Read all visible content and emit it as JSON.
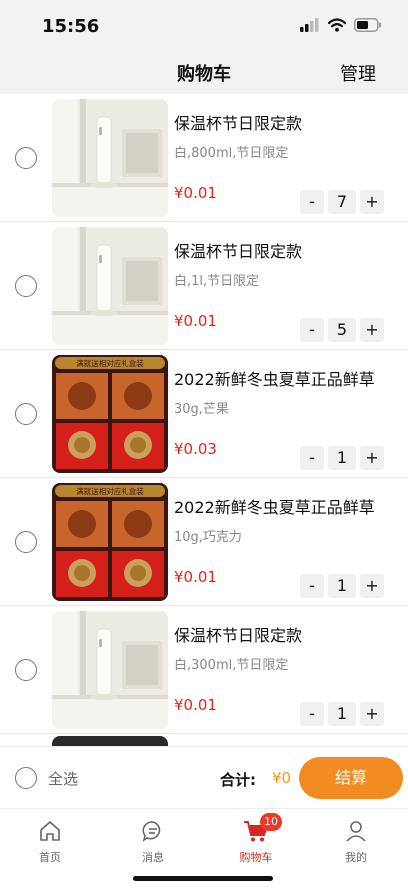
{
  "status_bar": {
    "time": "15:56"
  },
  "nav": {
    "title": "购物车",
    "manage": "管理"
  },
  "items": [
    {
      "name": "保温杯节日限定款",
      "spec": "白,800ml,节日限定",
      "price": "¥0.01",
      "qty": "7",
      "thumb": "thermos"
    },
    {
      "name": "保温杯节日限定款",
      "spec": "白,1l,节日限定",
      "price": "¥0.01",
      "qty": "5",
      "thumb": "thermos"
    },
    {
      "name": "2022新鲜冬虫夏草正品鲜草",
      "spec": "30g,芒果",
      "price": "¥0.03",
      "qty": "1",
      "thumb": "cordyceps"
    },
    {
      "name": "2022新鲜冬虫夏草正品鲜草",
      "spec": "10g,巧克力",
      "price": "¥0.01",
      "qty": "1",
      "thumb": "cordyceps"
    },
    {
      "name": "保温杯节日限定款",
      "spec": "白,300ml,节日限定",
      "price": "¥0.01",
      "qty": "1",
      "thumb": "thermos"
    }
  ],
  "thumb_text": {
    "cordyceps_banner": "满就送相对应礼盒装"
  },
  "stepper": {
    "minus": "-",
    "plus": "+"
  },
  "footer": {
    "select_all": "全选",
    "total_label": "合计:",
    "total_value": "¥0",
    "checkout": "结算"
  },
  "tabs": [
    {
      "label": "首页",
      "icon": "home-icon"
    },
    {
      "label": "消息",
      "icon": "message-icon"
    },
    {
      "label": "购物车",
      "icon": "cart-icon",
      "badge": "10",
      "active": true
    },
    {
      "label": "我的",
      "icon": "profile-icon"
    }
  ],
  "colors": {
    "price": "#e0251c",
    "accent": "#f28b21",
    "total": "#f19a16",
    "tab_active": "#d6281e",
    "badge": "#e93a2b"
  }
}
